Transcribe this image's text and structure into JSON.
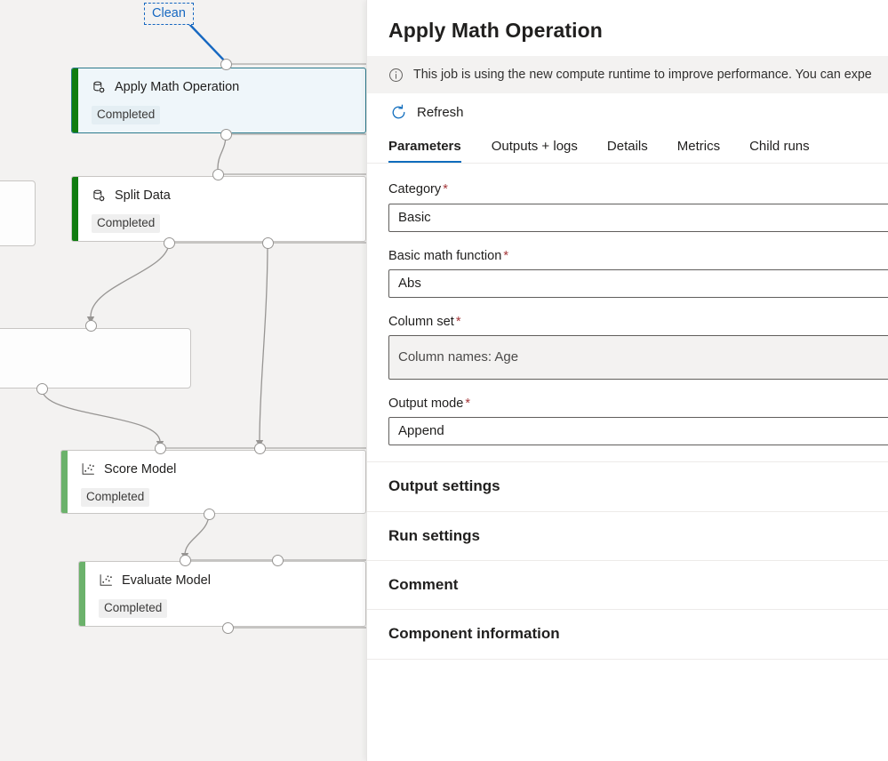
{
  "canvas": {
    "clean_chip": {
      "label": "Clean"
    },
    "nodes": [
      {
        "id": "apply-math-operation",
        "title": "Apply Math Operation",
        "status": "Completed",
        "icon": "database-gear-icon",
        "selected": true
      },
      {
        "id": "split-data",
        "title": "Split Data",
        "status": "Completed",
        "icon": "database-gear-icon",
        "selected": false
      },
      {
        "id": "score-model",
        "title": "Score Model",
        "status": "Completed",
        "icon": "scatter-plot-icon",
        "selected": false
      },
      {
        "id": "evaluate-model",
        "title": "Evaluate Model",
        "status": "Completed",
        "icon": "scatter-plot-icon",
        "selected": false
      }
    ],
    "colors": {
      "background": "#f3f2f1",
      "selected_fill": "#eff6fa",
      "selected_border": "#2b7a8c",
      "status_stripe": "#107c10",
      "status_stripe_light": "#6bb26b",
      "clean_accent": "#1668c1",
      "edge": "#979593"
    }
  },
  "panel": {
    "title": "Apply Math Operation",
    "banner": {
      "icon": "info-icon",
      "text": "This job is using the new compute runtime to improve performance. You can expe"
    },
    "toolbar": {
      "refresh_label": "Refresh",
      "refresh_icon": "refresh-icon"
    },
    "tabs": [
      {
        "label": "Parameters",
        "active": true
      },
      {
        "label": "Outputs + logs",
        "active": false
      },
      {
        "label": "Details",
        "active": false
      },
      {
        "label": "Metrics",
        "active": false
      },
      {
        "label": "Child runs",
        "active": false
      }
    ],
    "fields": [
      {
        "label": "Category",
        "required": true,
        "value": "Basic",
        "readonly": false
      },
      {
        "label": "Basic math function",
        "required": true,
        "value": "Abs",
        "readonly": false
      },
      {
        "label": "Column set",
        "required": true,
        "value": "Column names: Age",
        "readonly": true
      },
      {
        "label": "Output mode",
        "required": true,
        "value": "Append",
        "readonly": false
      }
    ],
    "sections": [
      {
        "label": "Output settings"
      },
      {
        "label": "Run settings"
      },
      {
        "label": "Comment"
      },
      {
        "label": "Component information"
      }
    ],
    "colors": {
      "accent": "#0f6cbd",
      "required_asterisk": "#a4373a",
      "banner_bg": "#f3f2f1"
    }
  }
}
